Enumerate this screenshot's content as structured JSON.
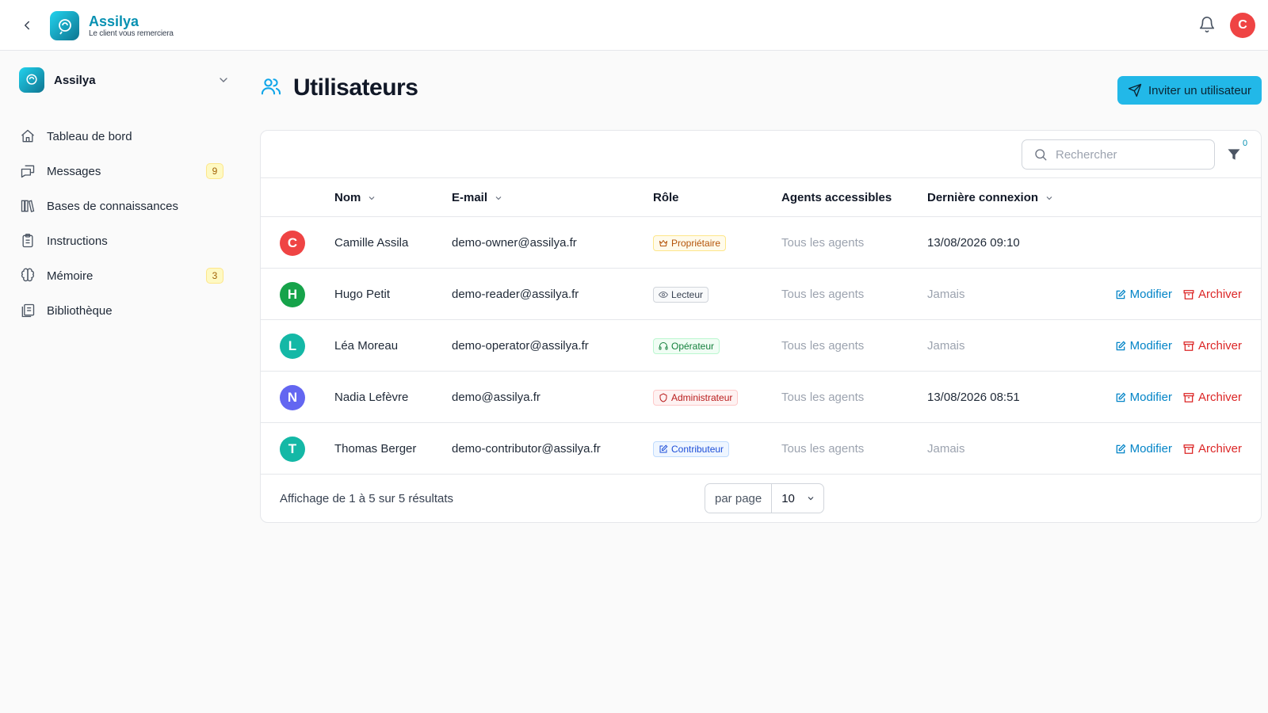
{
  "app": {
    "name": "Assilya",
    "tagline": "Le client vous remerciera",
    "user_initial": "C"
  },
  "colors": {
    "accent": "#22b8e8",
    "brand": "#0891b2",
    "danger": "#dc2626",
    "link": "#0284c7"
  },
  "sidebar": {
    "org_name": "Assilya",
    "items": [
      {
        "label": "Tableau de bord",
        "icon": "home-icon",
        "badge": ""
      },
      {
        "label": "Messages",
        "icon": "messages-icon",
        "badge": "9"
      },
      {
        "label": "Bases de connaissances",
        "icon": "books-icon",
        "badge": ""
      },
      {
        "label": "Instructions",
        "icon": "clipboard-icon",
        "badge": ""
      },
      {
        "label": "Mémoire",
        "icon": "brain-icon",
        "badge": "3"
      },
      {
        "label": "Bibliothèque",
        "icon": "library-icon",
        "badge": ""
      }
    ]
  },
  "page": {
    "title": "Utilisateurs",
    "invite_label": "Inviter un utilisateur"
  },
  "toolbar": {
    "search_placeholder": "Rechercher",
    "filter_count": "0"
  },
  "table": {
    "headers": {
      "name": "Nom",
      "email": "E-mail",
      "role": "Rôle",
      "agents": "Agents accessibles",
      "last_login": "Dernière connexion"
    },
    "edit_label": "Modifier",
    "archive_label": "Archiver",
    "rows": [
      {
        "initial": "C",
        "avatar_color": "#ef4444",
        "name": "Camille Assila",
        "email": "demo-owner@assilya.fr",
        "role": "Propriétaire",
        "role_icon": "crown-icon",
        "agents": "Tous les agents",
        "last_login": "13/08/2026 09:10",
        "last_login_muted": false,
        "actions": false
      },
      {
        "initial": "H",
        "avatar_color": "#16a34a",
        "name": "Hugo Petit",
        "email": "demo-reader@assilya.fr",
        "role": "Lecteur",
        "role_icon": "eye-icon",
        "agents": "Tous les agents",
        "last_login": "Jamais",
        "last_login_muted": true,
        "actions": true
      },
      {
        "initial": "L",
        "avatar_color": "#14b8a6",
        "name": "Léa Moreau",
        "email": "demo-operator@assilya.fr",
        "role": "Opérateur",
        "role_icon": "headset-icon",
        "agents": "Tous les agents",
        "last_login": "Jamais",
        "last_login_muted": true,
        "actions": true
      },
      {
        "initial": "N",
        "avatar_color": "#6366f1",
        "name": "Nadia Lefèvre",
        "email": "demo@assilya.fr",
        "role": "Administrateur",
        "role_icon": "shield-icon",
        "agents": "Tous les agents",
        "last_login": "13/08/2026 08:51",
        "last_login_muted": false,
        "actions": true
      },
      {
        "initial": "T",
        "avatar_color": "#14b8a6",
        "name": "Thomas Berger",
        "email": "demo-contributor@assilya.fr",
        "role": "Contributeur",
        "role_icon": "edit-icon",
        "agents": "Tous les agents",
        "last_login": "Jamais",
        "last_login_muted": true,
        "actions": true
      }
    ]
  },
  "footer": {
    "results_text": "Affichage de 1 à 5 sur 5 résultats",
    "per_page_label": "par page",
    "per_page_value": "10"
  }
}
